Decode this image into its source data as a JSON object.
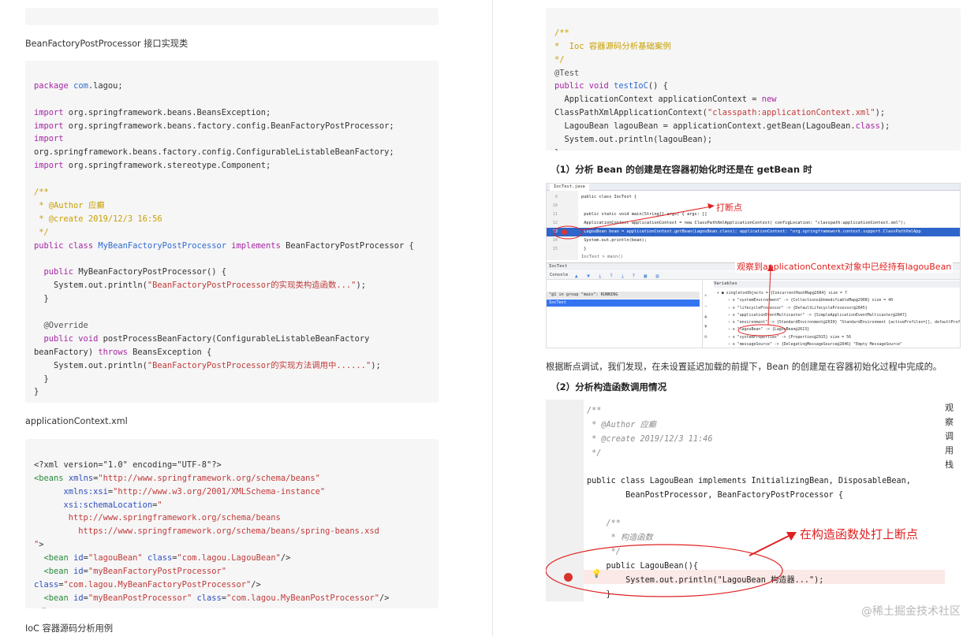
{
  "left": {
    "interface_heading": "BeanFactoryPostProcessor 接口实现类",
    "xml_heading": "applicationContext.xml",
    "bottom_heading": "IoC 容器源码分析用例"
  },
  "right": {
    "section1_title": "（1）分析 Bean 的创建是在容器初始化时还是在 getBean 时",
    "conclusion": "根据断点调试，我们发现，在未设置延迟加载的前提下，Bean 的创建是在容器初始化过程中完成的。",
    "section2_title": "（2）分析构造函数调用情况",
    "annotation_break": "打断点",
    "annotation_observe": "观察到applicationContext对象中已经持有lagouBean",
    "annotation_constructor": "在构造函数处打上断点",
    "side_note": "观察调用栈"
  },
  "ide1": {
    "tab": "IocTest.java",
    "lines": [
      {
        "n": "9",
        "text": "public class IocTest {"
      },
      {
        "n": "10",
        "text": ""
      },
      {
        "n": "11",
        "text": "    public static void main(String[] args) {  args: []"
      },
      {
        "n": "12",
        "text": "        ApplicationContext applicationContext = new ClassPathXmlApplicationContext(  configLocation: \"classpath:applicationContext.xml\");"
      },
      {
        "n": "13",
        "text": "        LagouBean bean = applicationContext.getBean(LagouBean.class);   applicationContext: \"org.springframework.context.support.ClassPathXmlApp"
      },
      {
        "n": "14",
        "text": "        System.out.println(bean);"
      },
      {
        "n": "15",
        "text": "    }"
      }
    ],
    "breadcrumb": "IocTest  >  main()",
    "debug_tab": "IocTest",
    "console_label": "Console",
    "thread": "\"@1 in group \"main\": RUNNING",
    "frame": "IocTest",
    "variables_label": "Variables",
    "vars": [
      "singletonObjects = {ConcurrentHashMap@2684}  size = 7",
      "\"systemEnvironment\" -> {Collections$UnmodifiableMap@2908}  size = 40",
      "\"lifecycleProcessor\" -> {DefaultLifecycleProcessor@2845}",
      "\"applicationEventMulticaster\" -> {SimpleApplicationEventMulticaster@2847}",
      "\"environment\" -> {StandardEnvironment@2639} \"StandardEnvironment {activeProfiles=[], defaultProfi",
      "\"lagouBean\" -> {LagouBean@2613}",
      "\"systemProperties\" -> {Properties@2915}  size = 56",
      "\"messageSource\" -> {DelegatingMessageSource@2846} \"Empty MessageSource\""
    ]
  },
  "ide2": {
    "lines": [
      "/**",
      " * @Author 应癫",
      " * @create 2019/12/3 11:46",
      " */",
      "",
      "public class LagouBean implements InitializingBean, DisposableBean,",
      "        BeanPostProcessor, BeanFactoryPostProcessor {",
      "",
      "    /**",
      "     * 构造函数",
      "     */",
      "    public LagouBean(){",
      "        System.out.println(\"LagouBean 构造器...\");",
      "    }"
    ]
  },
  "watermark": "@稀土掘金技术社区",
  "colors": {
    "code_bg": "#f6f6f6",
    "keyword": "#a626a4",
    "string": "#c13a3a",
    "annotation_red": "#e02020",
    "tag": "#2a8a3e"
  }
}
